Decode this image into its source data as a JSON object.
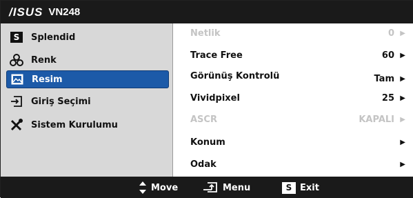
{
  "header": {
    "brand": "/ISUS",
    "model": "VN248"
  },
  "sidebar": {
    "items": [
      {
        "label": "Splendid",
        "icon": "splendid-s-icon"
      },
      {
        "label": "Renk",
        "icon": "color-palette-icon"
      },
      {
        "label": "Resim",
        "icon": "picture-icon",
        "selected": true
      },
      {
        "label": "Giriş Seçimi",
        "icon": "input-arrow-icon"
      },
      {
        "label": "Sistem Kurulumu",
        "icon": "tools-icon"
      }
    ],
    "splendid_glyph": "S"
  },
  "menu": {
    "rows": [
      {
        "label": "Netlik",
        "value": "0",
        "disabled": true
      },
      {
        "label": "Trace Free",
        "value": "60",
        "disabled": false
      },
      {
        "label": "Görünüş Kontrolü",
        "value": "Tam",
        "disabled": false
      },
      {
        "label": "Vividpixel",
        "value": "25",
        "disabled": false
      },
      {
        "label": "ASCR",
        "value": "KAPALI",
        "disabled": true
      },
      {
        "label": "Konum",
        "value": "",
        "disabled": false
      },
      {
        "label": "Odak",
        "value": "",
        "disabled": false
      }
    ],
    "arrow_glyph": "▶"
  },
  "footer": {
    "move_label": "Move",
    "menu_label": "Menu",
    "exit_label": "Exit",
    "exit_glyph": "S"
  },
  "colors": {
    "header_bg": "#1a1a1a",
    "sidebar_bg": "#d8d8d8",
    "selected_bg": "#1c5aa8",
    "disabled_text": "#c4c4c4"
  }
}
